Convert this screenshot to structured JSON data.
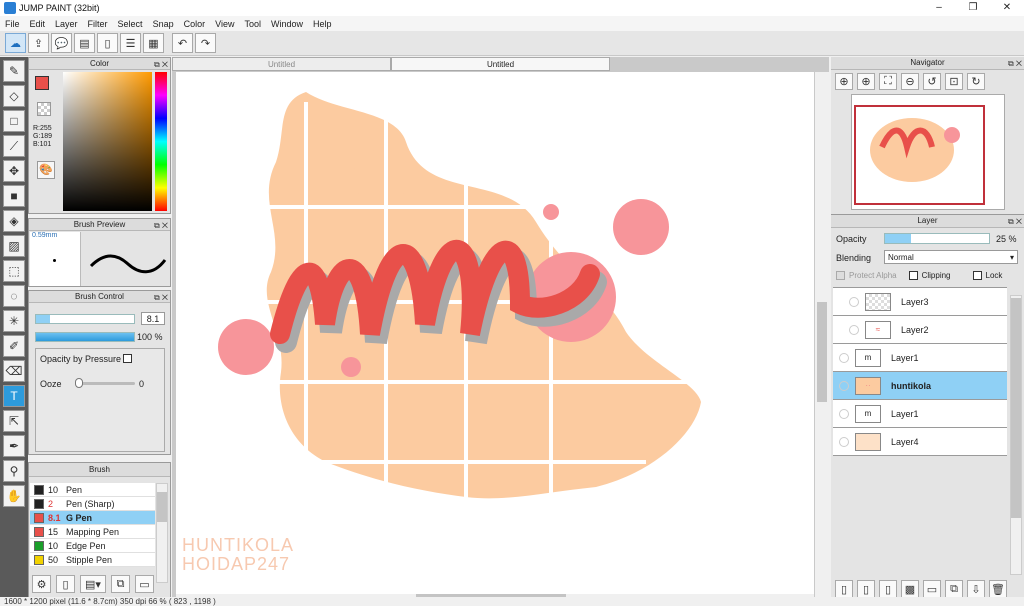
{
  "window": {
    "title": "JUMP PAINT (32bit)",
    "minimize": "–",
    "maximize": "❐",
    "close": "✕"
  },
  "menu": [
    "File",
    "Edit",
    "Layer",
    "Filter",
    "Select",
    "Snap",
    "Color",
    "View",
    "Tool",
    "Window",
    "Help"
  ],
  "toolbar": {
    "buttons": [
      "cloud-icon",
      "export-icon",
      "comment-icon",
      "chat-icon",
      "document-icon",
      "list-icon",
      "grid-icon",
      "undo-icon",
      "redo-icon"
    ]
  },
  "color_panel": {
    "title": "Color",
    "rgb": [
      "R:255",
      "G:189",
      "B:101"
    ],
    "primary_color": "#e8504a",
    "secondary_color": "#ffffff"
  },
  "brush_preview": {
    "title": "Brush Preview",
    "size_label": "0.59mm"
  },
  "brush_control": {
    "title": "Brush Control",
    "size_value": "8.1",
    "opacity_value": "100 %",
    "opacity_by_pressure": "Opacity by Pressure",
    "ooze_label": "Ooze",
    "ooze_value": "0"
  },
  "brush_list": {
    "title": "Brush",
    "items": [
      {
        "size": "10",
        "name": "Pen",
        "color": "#222222",
        "active": false
      },
      {
        "size": "2",
        "name": "Pen (Sharp)",
        "color": "#222222",
        "active": false
      },
      {
        "size": "8.1",
        "name": "G Pen",
        "color": "#e8504a",
        "active": true
      },
      {
        "size": "15",
        "name": "Mapping Pen",
        "color": "#e8504a",
        "active": false
      },
      {
        "size": "10",
        "name": "Edge Pen",
        "color": "#1a9e2a",
        "active": false
      },
      {
        "size": "50",
        "name": "Stipple Pen",
        "color": "#f2d200",
        "active": false
      }
    ]
  },
  "canvas": {
    "tabs": [
      "Untitled",
      "Untitled"
    ],
    "watermark_line1": "HUNTIKOLA",
    "watermark_line2": "HOIDAP247"
  },
  "navigator": {
    "title": "Navigator"
  },
  "layer_panel": {
    "title": "Layer",
    "opacity_label": "Opacity",
    "opacity_value": "25 %",
    "opacity_fraction": 0.25,
    "blending_label": "Blending",
    "blending_value": "Normal",
    "protect_alpha": "Protect Alpha",
    "clipping": "Clipping",
    "lock": "Lock",
    "layers": [
      {
        "name": "Layer3",
        "active": false
      },
      {
        "name": "Layer2",
        "active": false
      },
      {
        "name": "Layer1",
        "active": false
      },
      {
        "name": "huntikola",
        "active": true
      },
      {
        "name": "Layer1",
        "active": false
      },
      {
        "name": "Layer4",
        "active": false
      }
    ]
  },
  "status": "1600 * 1200 pixel   (11.6 * 8.7cm)   350 dpi   66 %   ( 823 , 1198 )"
}
